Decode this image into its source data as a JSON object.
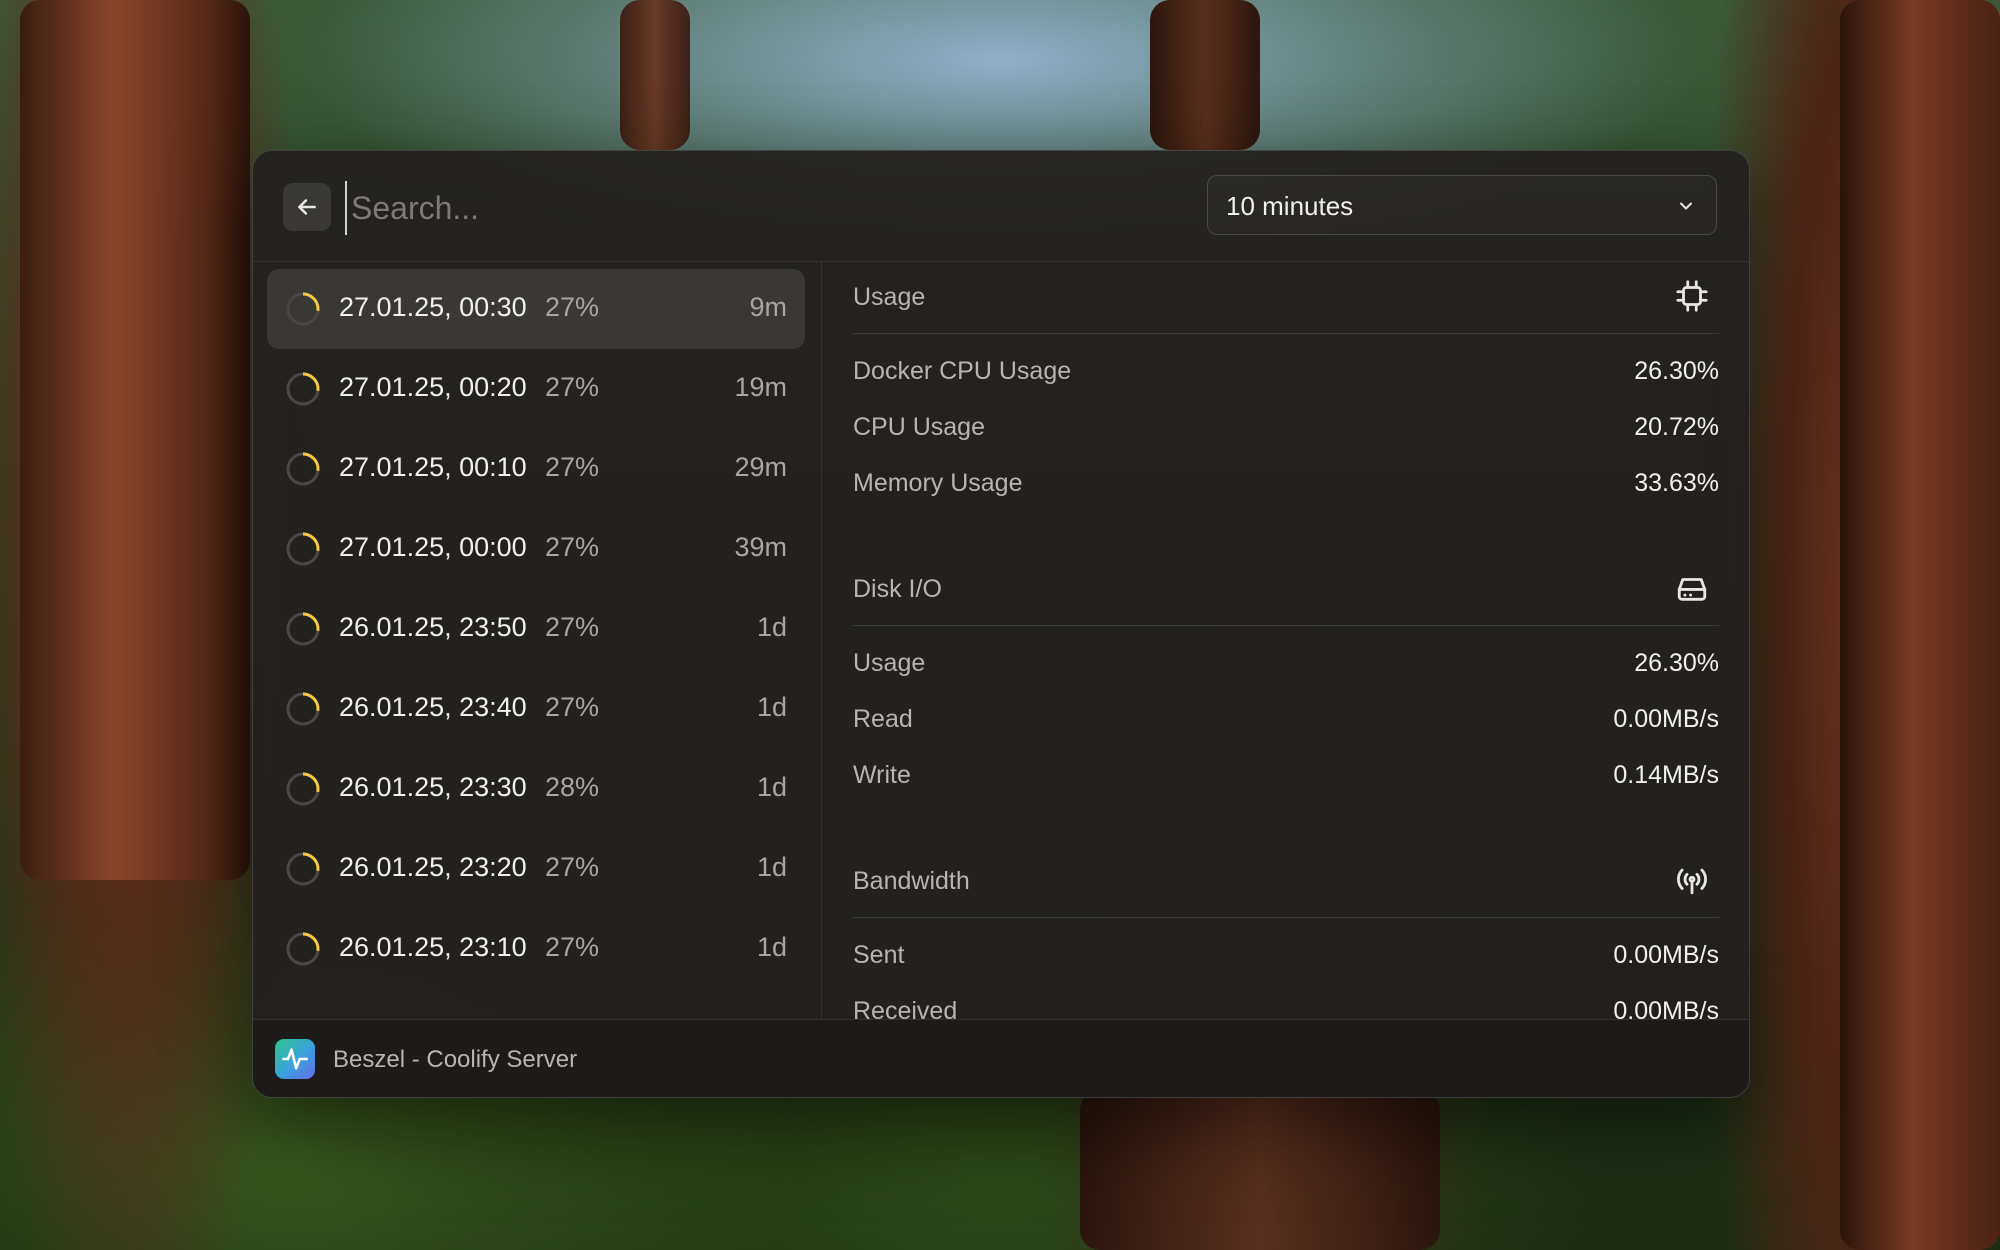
{
  "search": {
    "placeholder": "Search..."
  },
  "interval": {
    "selected": "10 minutes"
  },
  "snapshots": [
    {
      "date": "27.01.25, 00:30",
      "percent": "27%",
      "age": "9m",
      "selected": true
    },
    {
      "date": "27.01.25, 00:20",
      "percent": "27%",
      "age": "19m"
    },
    {
      "date": "27.01.25, 00:10",
      "percent": "27%",
      "age": "29m"
    },
    {
      "date": "27.01.25, 00:00",
      "percent": "27%",
      "age": "39m"
    },
    {
      "date": "26.01.25, 23:50",
      "percent": "27%",
      "age": "1d"
    },
    {
      "date": "26.01.25, 23:40",
      "percent": "27%",
      "age": "1d"
    },
    {
      "date": "26.01.25, 23:30",
      "percent": "28%",
      "age": "1d"
    },
    {
      "date": "26.01.25, 23:20",
      "percent": "27%",
      "age": "1d"
    },
    {
      "date": "26.01.25, 23:10",
      "percent": "27%",
      "age": "1d"
    }
  ],
  "details": {
    "usage": {
      "title": "Usage",
      "icon": "cpu-icon",
      "items": [
        {
          "label": "Docker CPU Usage",
          "value": "26.30%"
        },
        {
          "label": "CPU Usage",
          "value": "20.72%"
        },
        {
          "label": "Memory Usage",
          "value": "33.63%"
        }
      ]
    },
    "disk": {
      "title": "Disk I/O",
      "icon": "hard-drive-icon",
      "items": [
        {
          "label": "Usage",
          "value": "26.30%"
        },
        {
          "label": "Read",
          "value": "0.00MB/s"
        },
        {
          "label": "Write",
          "value": "0.14MB/s"
        }
      ]
    },
    "bandwidth": {
      "title": "Bandwidth",
      "icon": "antenna-icon",
      "items": [
        {
          "label": "Sent",
          "value": "0.00MB/s"
        },
        {
          "label": "Received",
          "value": "0.00MB/s"
        }
      ]
    }
  },
  "footer": {
    "title": "Beszel - Coolify Server"
  },
  "colors": {
    "accent": "#f5c842",
    "ring": "#4a4744"
  }
}
